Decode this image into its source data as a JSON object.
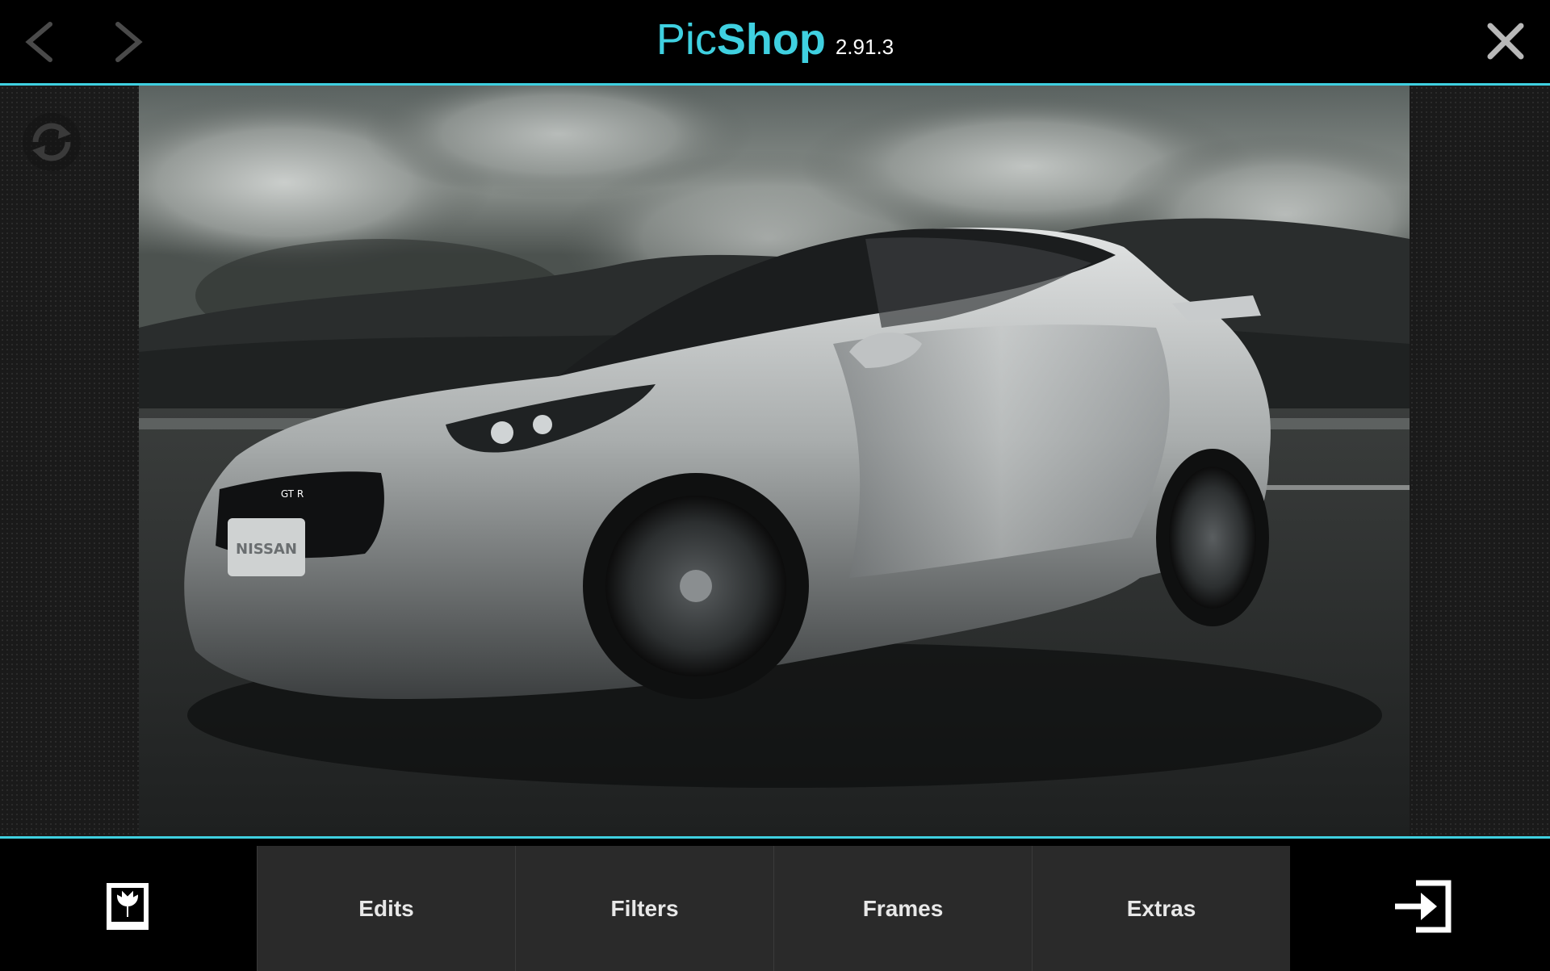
{
  "header": {
    "title_pic": "Pic",
    "title_shop": "Shop",
    "version": "2.91.3",
    "back_icon": "chevron-left-icon",
    "forward_icon": "chevron-right-icon",
    "close_icon": "close-icon"
  },
  "main": {
    "rotate_icon": "rotate-icon",
    "photo_subject": "silver sports car on road",
    "photo_badge_text": "NISSAN",
    "photo_emblem_text": "GT R"
  },
  "toolbar": {
    "gallery_icon": "gallery-icon",
    "tabs": [
      {
        "label": "Edits"
      },
      {
        "label": "Filters"
      },
      {
        "label": "Frames"
      },
      {
        "label": "Extras"
      }
    ],
    "export_icon": "export-icon"
  },
  "colors": {
    "accent": "#3fd0e0",
    "background": "#000000",
    "tab_bg": "#2a2a2a"
  }
}
